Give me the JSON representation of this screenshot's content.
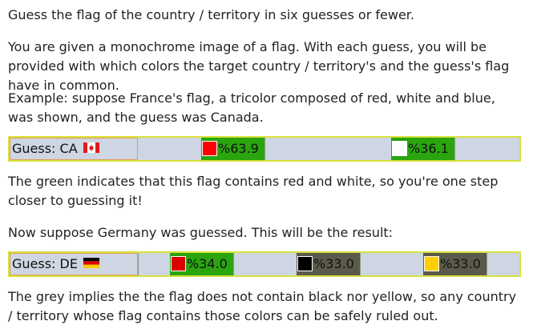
{
  "intro": "Guess the flag of the country / territory in six guesses or fewer.",
  "monochrome": "You are given a monochrome image of a flag. With each guess, you will be provided with which colors the target country / territory's and the guess's flag have in common.",
  "example": "Example: suppose France's flag, a tricolor composed of red, white and blue, was shown, and the guess was Canada.",
  "green_note": "The green indicates that this flag contains red and white, so you're one step closer to guessing it!",
  "germany_note": "Now suppose Germany was guessed. This will be the result:",
  "grey_note": "The grey implies the the flag does not contain black nor yellow, so any country / territory whose flag contains those colors can be safely ruled out.",
  "colors": {
    "match": "#2aa50f",
    "no_match": "#5b5a4a",
    "row_border": "#d6e23a",
    "row_bg": "#cdd6e2"
  },
  "guess_ca": {
    "label": "Guess: CA",
    "flag_icon": "canada-flag-icon",
    "results": [
      {
        "color": "#ff0000",
        "percent": "%63.9",
        "status": "match"
      },
      {
        "color": "#ffffff",
        "percent": "%36.1",
        "status": "match"
      }
    ]
  },
  "guess_de": {
    "label": "Guess: DE",
    "flag_icon": "germany-flag-icon",
    "results": [
      {
        "color": "#dd0000",
        "percent": "%34.0",
        "status": "match"
      },
      {
        "color": "#000000",
        "percent": "%33.0",
        "status": "no-match"
      },
      {
        "color": "#ffce00",
        "percent": "%33.0",
        "status": "no-match"
      }
    ]
  }
}
